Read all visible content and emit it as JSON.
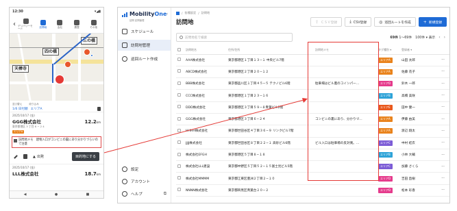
{
  "phone": {
    "time": "12:30",
    "tabs": [
      {
        "label": "デリバリーモード",
        "active": false
      },
      {
        "label": "訪問地",
        "active": true
      },
      {
        "label": "会社",
        "active": false
      },
      {
        "label": "履歴",
        "active": false
      },
      {
        "label": "その他",
        "active": false
      }
    ],
    "map": {
      "stations": [
        "四の橋",
        "三の橋",
        "天棒寺"
      ]
    },
    "stops_header": {
      "left": "並び替え",
      "right": "絞り込み"
    },
    "stops_values": {
      "date": "1/6 日付順",
      "area": "エリアA"
    },
    "card1": {
      "date": "2025/10/17 (金)",
      "name": "GGG株式会社",
      "distance": "12.2",
      "distance_unit": "km",
      "address": "東京都港区 3 丁目 6 − 2 4",
      "area": "エリアA"
    },
    "memo": {
      "label": "訪問地メモ",
      "text": "建物入口がコンビニの裏にあり分かりづらいので注意"
    },
    "actions": {
      "out": "出発",
      "primary": "目的地にする"
    },
    "card2": {
      "date": "2025/10/17 (金)",
      "name": "LLL株式会社",
      "distance": "18.7",
      "distance_unit": "km"
    },
    "sysnav": [
      "◀",
      "●",
      "■"
    ]
  },
  "desktop": {
    "brand": {
      "name_a": "Mobility",
      "name_b": "One",
      "sub": "訪問 訪問管理"
    },
    "nav": [
      {
        "label": "スケジュール",
        "active": false
      },
      {
        "label": "訪問地管理",
        "active": true
      },
      {
        "label": "巡回ルート作成",
        "active": false
      }
    ],
    "nav_bottom": [
      {
        "label": "設定"
      },
      {
        "label": "アカウント"
      },
      {
        "label": "ヘルプ"
      }
    ],
    "breadcrumb": [
      "各種設定",
      "訪問地"
    ],
    "title": "訪問地",
    "buttons": {
      "import": "ＣＳＶ登録",
      "csv": "CSV登録",
      "route": "巡回ルートを作成",
      "add": "新規登録"
    },
    "search_placeholder": "訪問地名で検索",
    "pager": {
      "total": "69件",
      "range": "1〜69件",
      "per_page": "100件 ▾",
      "display": "表示"
    },
    "columns": [
      "訪問地名",
      "住所/住所",
      "訪問地メモ",
      "タグ種別 ▾",
      "登録者 ▾"
    ],
    "rows": [
      {
        "name": "AAA株式会社",
        "address": "東京都港区１丁目１３−１ 中央ビル7階",
        "memo": "",
        "tag": "エリアA",
        "tag_color": "#e9831c",
        "user": "山田 太郎"
      },
      {
        "name": "ABCD株式会社",
        "address": "東京都港区２丁目２０−１２",
        "memo": "",
        "tag": "エリアA",
        "tag_color": "#e9831c",
        "user": "佐藤 花子"
      },
      {
        "name": "BBB株式会社",
        "address": "東京都品川区１丁目４５−５ テクノビル6階",
        "memo": "駐車場はビル裏のコインパー…",
        "tag": "エリアD",
        "tag_color": "#e53b8c",
        "user": "鈴木 一郎"
      },
      {
        "name": "CCC株式会社",
        "address": "東京都港区１丁目２３−１６",
        "memo": "",
        "tag": "エリアB",
        "tag_color": "#2ea3d8",
        "user": "高橋 美咲"
      },
      {
        "name": "DDD株式会社",
        "address": "東京都港区３丁目５９−８青葉ビル2階",
        "memo": "",
        "tag": "エリアE",
        "tag_color": "#e9581c",
        "user": "田中 健一"
      },
      {
        "name": "GGG株式会社",
        "address": "東京都港区３丁目６−２４",
        "memo": "コンビニの裏にあり、分かりづ…",
        "tag": "エリアA",
        "tag_color": "#e9831c",
        "user": "伊藤 由美"
      },
      {
        "name": "HHHH株式会社",
        "address": "東京都世田谷区４丁目３６−９ リンクビル7階",
        "memo": "",
        "tag": "エリアA",
        "tag_color": "#e9831c",
        "user": "渡辺 翔太"
      },
      {
        "name": "JJJJ株式会社",
        "address": "東京都世田谷区８丁目２２−１ 高砂ビル6階",
        "memo": "ビル入口は駐車場の反対側。…",
        "tag": "エリアC",
        "tag_color": "#7c5cd6",
        "user": "中村 結衣"
      },
      {
        "name": "株式会社EFGH",
        "address": "東京都港区５丁目８−１８",
        "memo": "",
        "tag": "エリアB",
        "tag_color": "#2ea3d8",
        "user": "小林 大輔"
      },
      {
        "name": "株式会社LLL建設",
        "address": "東京都中野区５丁目５２−１５富士見ビル5階",
        "memo": "",
        "tag": "エリアC",
        "tag_color": "#7c5cd6",
        "user": "加藤 さくら"
      },
      {
        "name": "株式会社MMMM",
        "address": "東京都江東区豊洲２丁目２−１０",
        "memo": "",
        "tag": "エリアD",
        "tag_color": "#e53b8c",
        "user": "吉田 直樹"
      },
      {
        "name": "NNNN株式会社",
        "address": "東京都目黒区青葉台２０−２",
        "memo": "",
        "tag": "エリアD",
        "tag_color": "#e53b8c",
        "user": "松本 彩香"
      }
    ]
  },
  "colors": {
    "accent": "#1e6bd6",
    "highlight": "#e53935",
    "area_a": "#e9831c"
  }
}
